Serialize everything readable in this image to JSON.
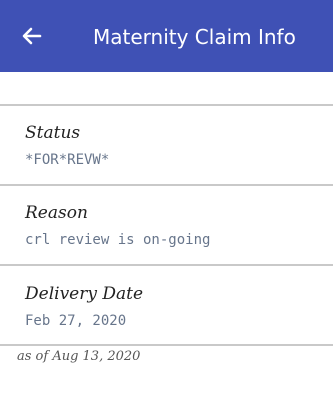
{
  "appbar": {
    "back_icon": "arrow-left-icon",
    "title": "Maternity Claim Info",
    "background_color": "#3f51b5"
  },
  "fields": [
    {
      "label": "Status",
      "value": "*FOR*REVW*"
    },
    {
      "label": "Reason",
      "value": "crl review is on-going"
    },
    {
      "label": "Delivery Date",
      "value": "Feb 27, 2020"
    }
  ],
  "as_of": "as of Aug 13, 2020",
  "colors": {
    "value_text": "#67758b",
    "divider": "#c9c9c9"
  }
}
